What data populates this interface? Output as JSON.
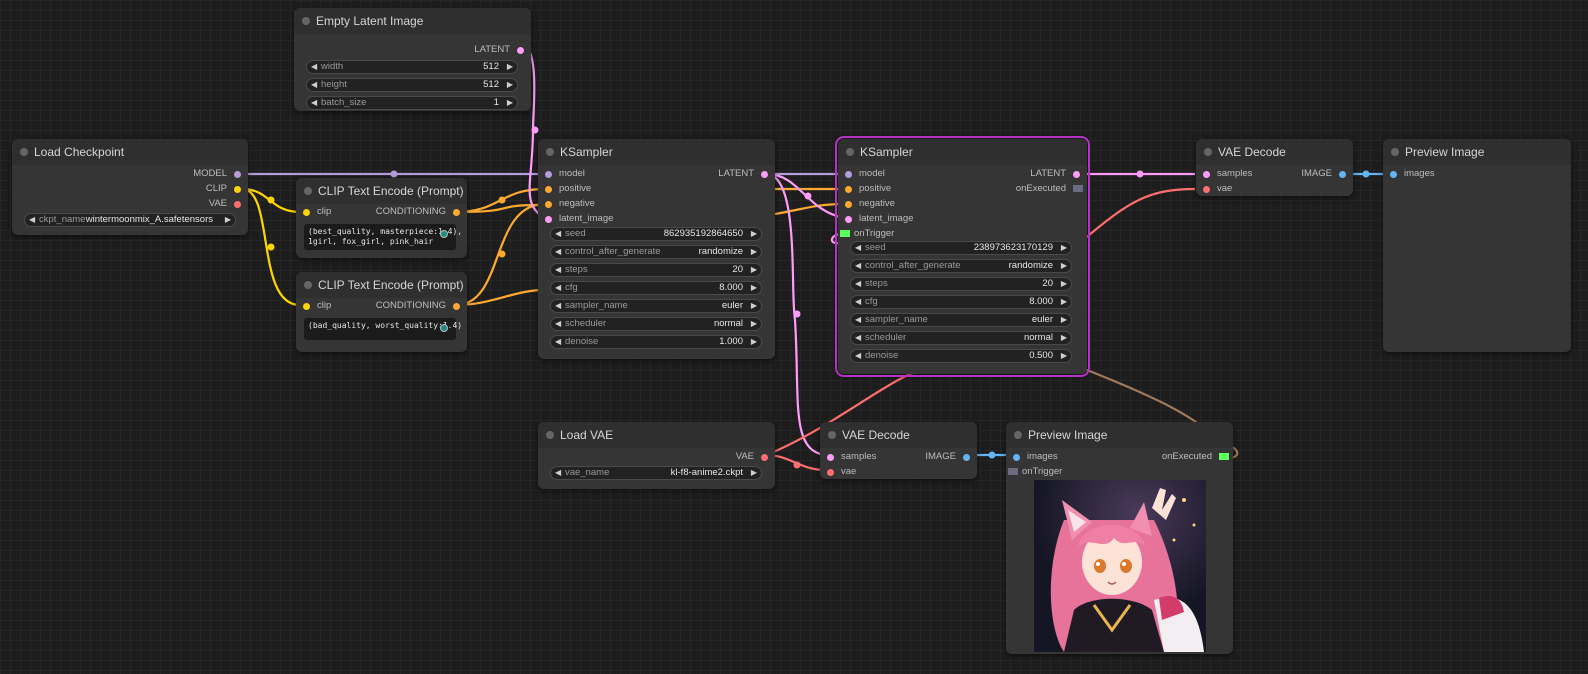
{
  "slot_colors": {
    "model": "#b39ddb",
    "clip": "#ffd500",
    "vae": "#ff6e6e",
    "conditioning": "#ffa931",
    "latent": "#ff9cf9",
    "image": "#64b5f6",
    "event": "#6a6a80"
  },
  "empty_latent": {
    "title": "Empty Latent Image",
    "out": "LATENT",
    "width_label": "width",
    "width_value": "512",
    "height_label": "height",
    "height_value": "512",
    "batch_label": "batch_size",
    "batch_value": "1"
  },
  "load_checkpoint": {
    "title": "Load Checkpoint",
    "out_model": "MODEL",
    "out_clip": "CLIP",
    "out_vae": "VAE",
    "ckpt_label": "ckpt_name",
    "ckpt_value": "wintermoonmix_A.safetensors"
  },
  "clip_pos": {
    "title": "CLIP Text Encode (Prompt)",
    "in_clip": "clip",
    "out": "CONDITIONING",
    "text": "(best_quality, masterpiece:1.4),\n1girl, fox_girl, pink_hair"
  },
  "clip_neg": {
    "title": "CLIP Text Encode (Prompt)",
    "in_clip": "clip",
    "out": "CONDITIONING",
    "text": "(bad_quality, worst_quality:1.4)"
  },
  "ksampler1": {
    "title": "KSampler",
    "in_model": "model",
    "in_positive": "positive",
    "in_negative": "negative",
    "in_latent": "latent_image",
    "out": "LATENT",
    "seed_label": "seed",
    "seed_value": "862935192864650",
    "cag_label": "control_after_generate",
    "cag_value": "randomize",
    "steps_label": "steps",
    "steps_value": "20",
    "cfg_label": "cfg",
    "cfg_value": "8.000",
    "sampler_label": "sampler_name",
    "sampler_value": "euler",
    "scheduler_label": "scheduler",
    "scheduler_value": "normal",
    "denoise_label": "denoise",
    "denoise_value": "1.000"
  },
  "ksampler2": {
    "title": "KSampler",
    "in_model": "model",
    "in_positive": "positive",
    "in_negative": "negative",
    "in_latent": "latent_image",
    "in_trigger": "onTrigger",
    "out": "LATENT",
    "out_executed": "onExecuted",
    "seed_label": "seed",
    "seed_value": "238973623170129",
    "cag_label": "control_after_generate",
    "cag_value": "randomize",
    "steps_label": "steps",
    "steps_value": "20",
    "cfg_label": "cfg",
    "cfg_value": "8.000",
    "sampler_label": "sampler_name",
    "sampler_value": "euler",
    "scheduler_label": "scheduler",
    "scheduler_value": "normal",
    "denoise_label": "denoise",
    "denoise_value": "0.500"
  },
  "vae_decode_top": {
    "title": "VAE Decode",
    "in_samples": "samples",
    "in_vae": "vae",
    "out": "IMAGE"
  },
  "preview_top": {
    "title": "Preview Image",
    "in_images": "images"
  },
  "load_vae": {
    "title": "Load VAE",
    "out": "VAE",
    "vae_label": "vae_name",
    "vae_value": "kl-f8-anime2.ckpt"
  },
  "vae_decode_bottom": {
    "title": "VAE Decode",
    "in_samples": "samples",
    "in_vae": "vae",
    "out": "IMAGE"
  },
  "preview_bottom": {
    "title": "Preview Image",
    "in_images": "images",
    "in_trigger": "onTrigger",
    "out_executed": "onExecuted"
  }
}
